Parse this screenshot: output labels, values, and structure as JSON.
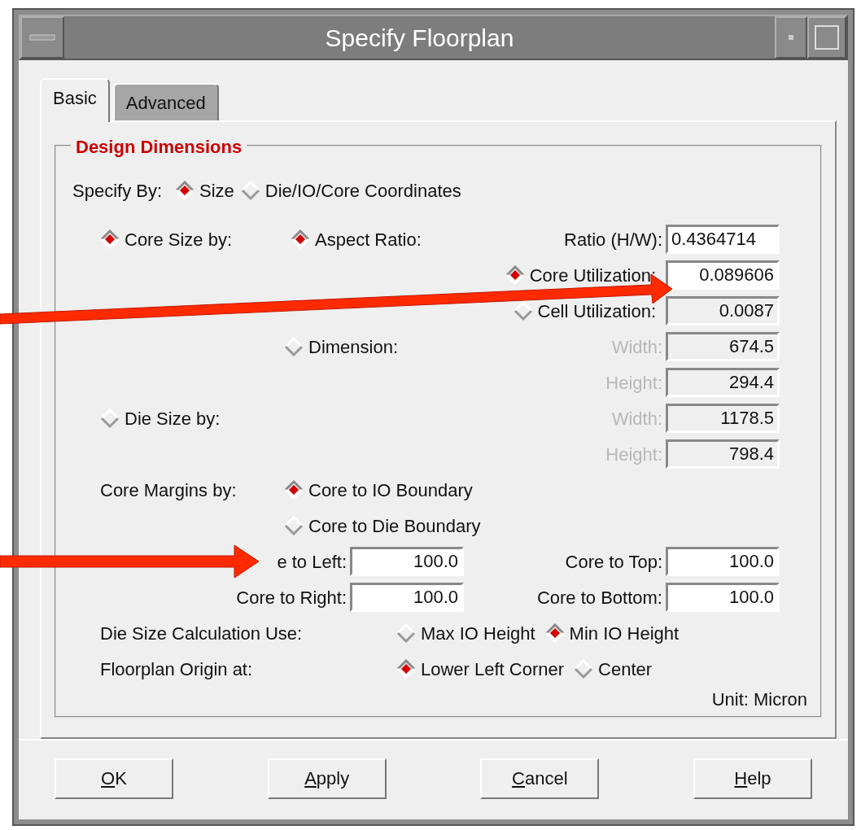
{
  "window": {
    "title": "Specify Floorplan"
  },
  "tabs": [
    {
      "label": "Basic",
      "selected": true
    },
    {
      "label": "Advanced",
      "selected": false
    }
  ],
  "group": {
    "title": "Design Dimensions"
  },
  "specify_by": {
    "label": "Specify By:",
    "options": [
      {
        "label": "Size",
        "selected": true
      },
      {
        "label": "Die/IO/Core Coordinates",
        "selected": false
      }
    ]
  },
  "core_size": {
    "label": "Core Size by:",
    "selected": true
  },
  "aspect_ratio": {
    "label": "Aspect Ratio:",
    "selected": true
  },
  "ratio": {
    "label": "Ratio (H/W):",
    "value": "0.4364714",
    "disabled": false
  },
  "core_utilization": {
    "label": "Core Utilization:",
    "selected": true,
    "value": "0.089606",
    "disabled": false
  },
  "cell_utilization": {
    "label": "Cell Utilization:",
    "selected": false,
    "value": "0.0087",
    "disabled": true
  },
  "dimension": {
    "label": "Dimension:",
    "selected": false,
    "fields": [
      {
        "label": "Width:",
        "value": "674.5",
        "disabled": true
      },
      {
        "label": "Height:",
        "value": "294.4",
        "disabled": true
      }
    ]
  },
  "die_size": {
    "label": "Die Size by:",
    "selected": false,
    "fields": [
      {
        "label": "Width:",
        "value": "1178.5",
        "disabled": true
      },
      {
        "label": "Height:",
        "value": "798.4",
        "disabled": true
      }
    ]
  },
  "core_margins": {
    "label": "Core Margins by:",
    "options": [
      {
        "label": "Core to IO Boundary",
        "selected": true
      },
      {
        "label": "Core to Die Boundary",
        "selected": false
      }
    ]
  },
  "margins": [
    {
      "label": "e to Left:",
      "value": "100.0"
    },
    {
      "label": "Core to Top:",
      "value": "100.0"
    },
    {
      "label": "Core to Right:",
      "value": "100.0"
    },
    {
      "label": "Core to Bottom:",
      "value": "100.0"
    }
  ],
  "die_size_calculation": {
    "label": "Die Size Calculation Use:",
    "options": [
      {
        "label": "Max IO Height",
        "selected": false
      },
      {
        "label": "Min IO Height",
        "selected": true
      }
    ]
  },
  "origin": {
    "label": "Floorplan Origin at:",
    "options": [
      {
        "label": "Lower Left Corner",
        "selected": true
      },
      {
        "label": "Center",
        "selected": false
      }
    ]
  },
  "unit": "Unit: Micron",
  "buttons": [
    {
      "mnemonic": "O",
      "rest": "K"
    },
    {
      "mnemonic": "A",
      "rest": "pply"
    },
    {
      "mnemonic": "C",
      "rest": "ancel"
    },
    {
      "mnemonic": "H",
      "rest": "elp"
    }
  ],
  "annotations": [
    {
      "kind": "arrow"
    },
    {
      "kind": "arrow"
    }
  ]
}
